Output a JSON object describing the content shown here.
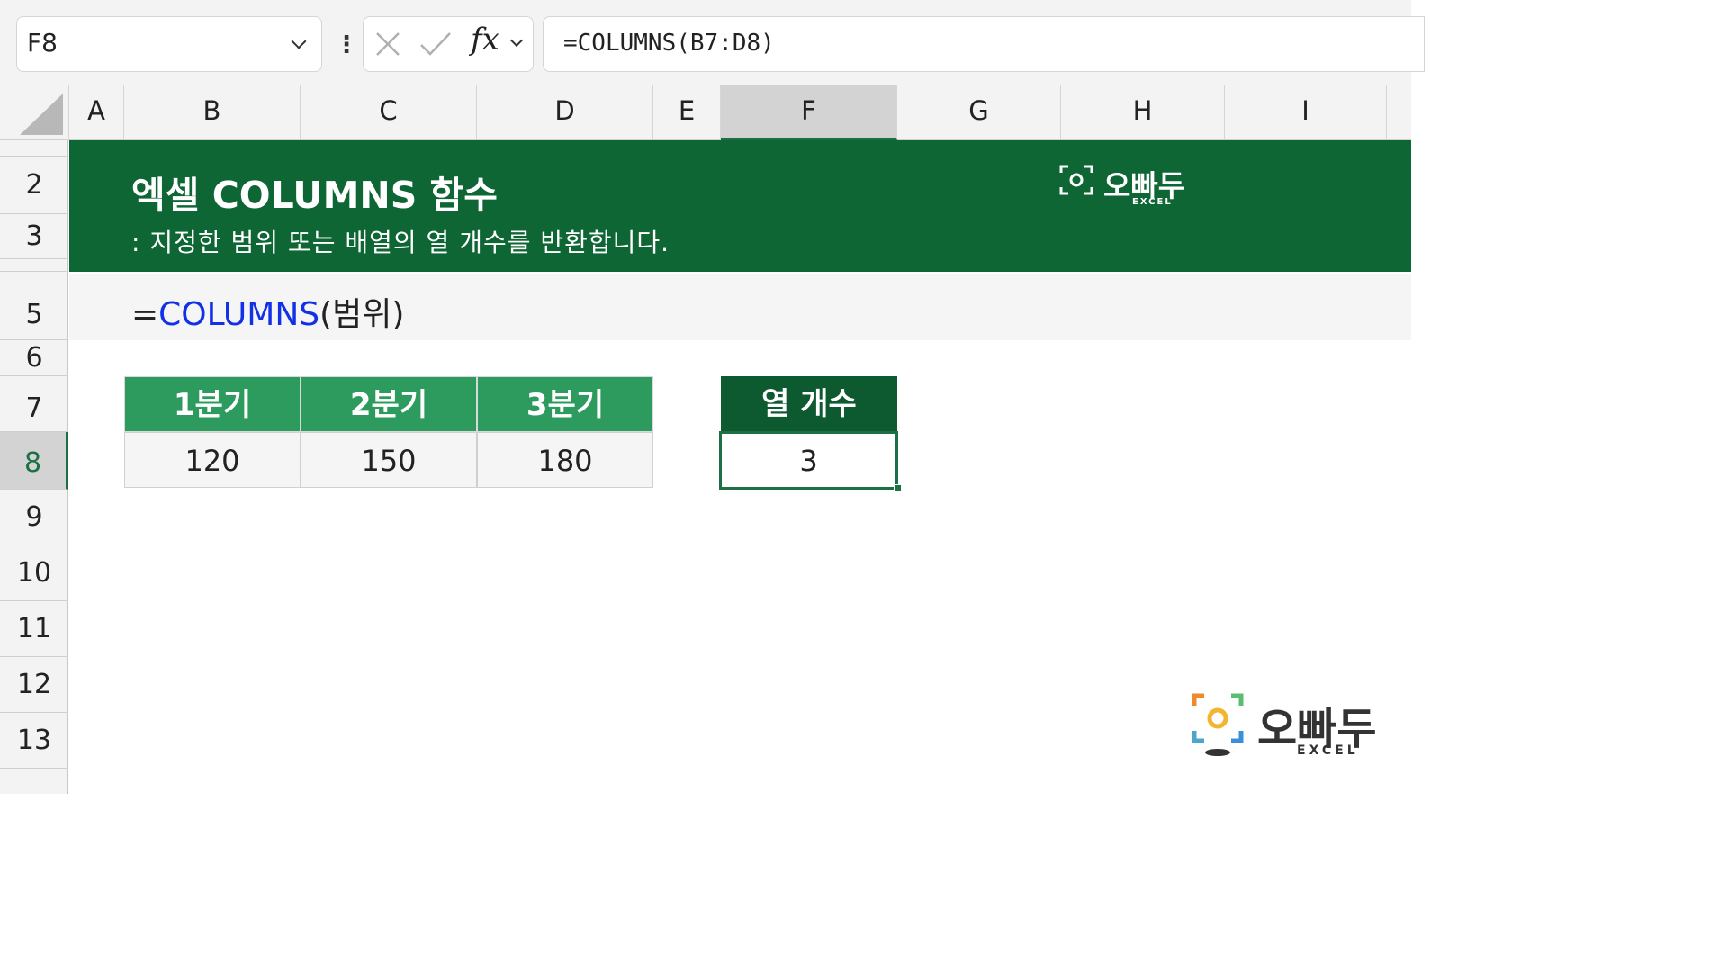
{
  "formula_bar": {
    "name_box": "F8",
    "formula": "=COLUMNS(B7:D8)"
  },
  "columns": [
    "A",
    "B",
    "C",
    "D",
    "E",
    "F",
    "G",
    "H",
    "I"
  ],
  "selected_column": "F",
  "rows": [
    "2",
    "3",
    "5",
    "6",
    "7",
    "8",
    "9",
    "10",
    "11",
    "12",
    "13"
  ],
  "selected_row": "8",
  "banner": {
    "title": "엑셀 COLUMNS 함수",
    "subtitle": ": 지정한 범위 또는 배열의 열 개수를 반환합니다.",
    "logo_text": "오빠두",
    "logo_sub": "EXCEL"
  },
  "syntax": {
    "prefix": "=",
    "function": "COLUMNS",
    "args": "(범위)"
  },
  "table": {
    "headers": [
      "1분기",
      "2분기",
      "3분기"
    ],
    "values": [
      "120",
      "150",
      "180"
    ]
  },
  "result": {
    "header": "열 개수",
    "value": "3"
  },
  "watermark": {
    "text": "오빠두",
    "sub": "EXCEL"
  },
  "colors": {
    "banner": "#0e6635",
    "table_header": "#2e9b5e",
    "result_header": "#0e5a30",
    "selection": "#1d7044",
    "function_blue": "#1230e8"
  }
}
